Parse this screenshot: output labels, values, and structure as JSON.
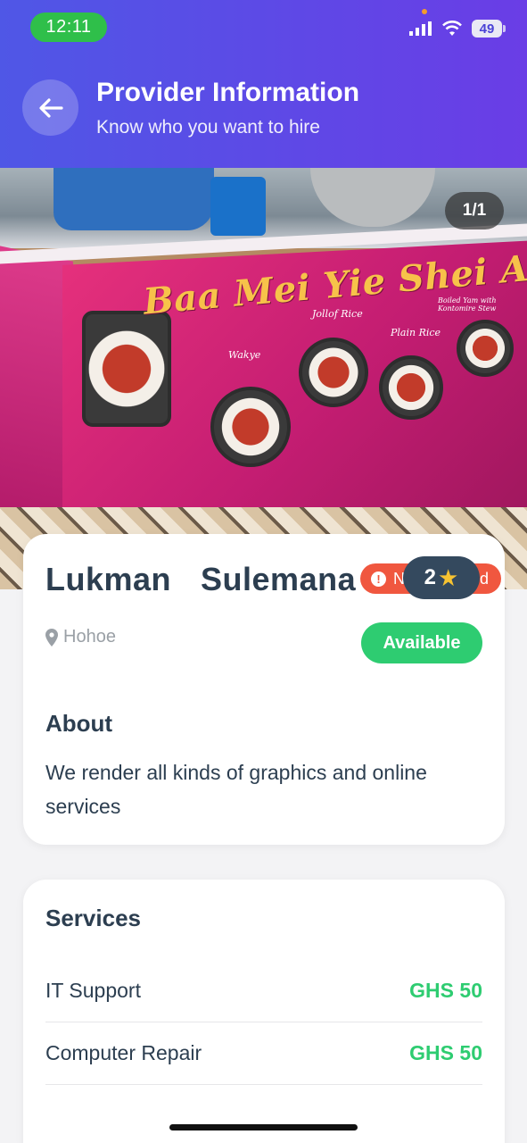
{
  "status_bar": {
    "time": "12:11",
    "battery": "49"
  },
  "header": {
    "title": "Provider Information",
    "subtitle": "Know who you want to hire"
  },
  "gallery": {
    "counter": "1/1",
    "sign": {
      "headline": "Baa Mei Yie Shei Allah",
      "dishes": [
        "Wakye",
        "Jollof Rice",
        "Plain Rice",
        "Boiled Yam with Kontomire Stew"
      ]
    }
  },
  "provider": {
    "name": "Lukman  Sulemana",
    "verification_partial_left": "N",
    "verification_partial_right": "d",
    "rating": "2",
    "location": "Hohoe",
    "availability": "Available",
    "about_title": "About",
    "about_text": "We render all kinds of graphics and online services"
  },
  "services": {
    "title": "Services",
    "items": [
      {
        "name": "IT Support",
        "price": "GHS 50"
      },
      {
        "name": "Computer Repair",
        "price": "GHS 50"
      }
    ]
  },
  "colors": {
    "header_start": "#4f57e6",
    "header_end": "#6a3de6",
    "available": "#2ecc71",
    "unverified": "#f0573f",
    "price": "#2ecc71"
  }
}
